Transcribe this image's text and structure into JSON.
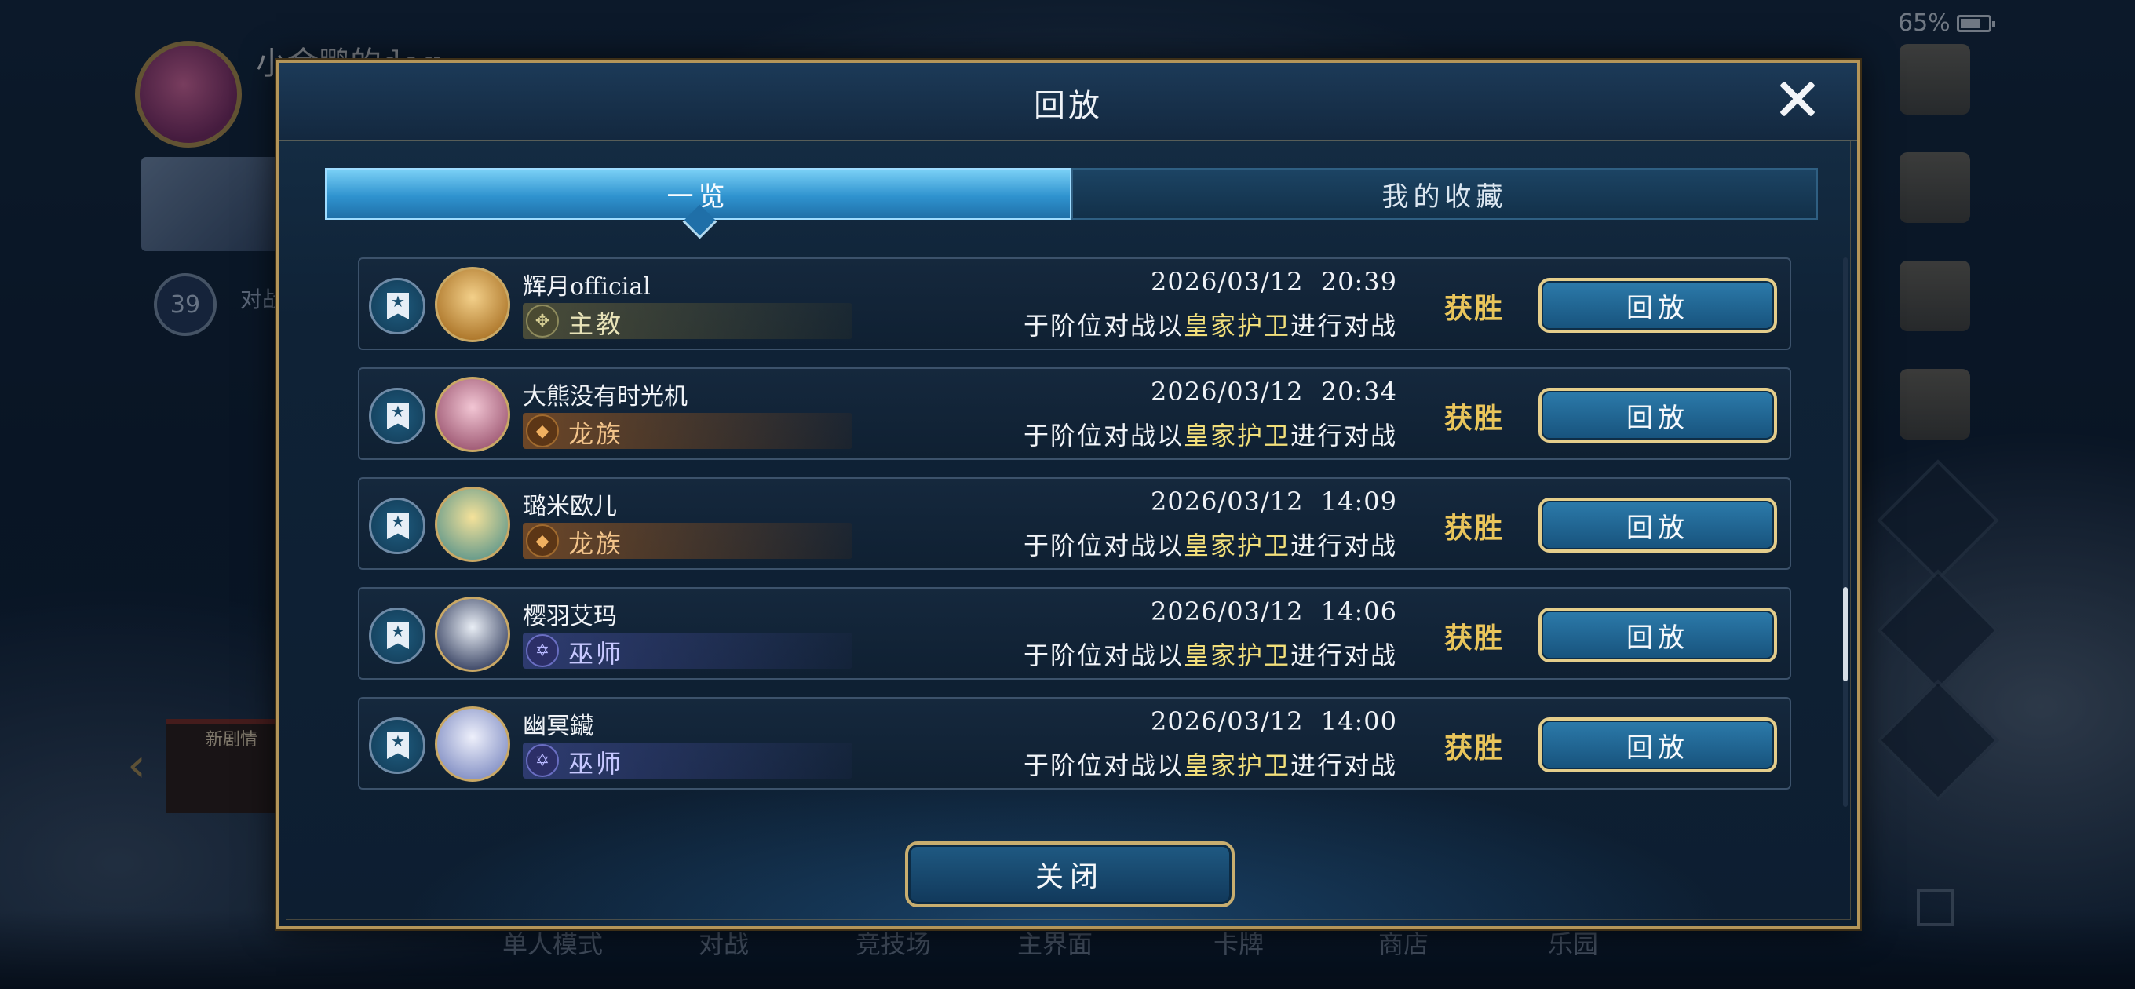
{
  "status_bar": {
    "battery": "65%"
  },
  "background": {
    "player_name": "小金鹏的dog",
    "level": "39",
    "level_text": "对战经验",
    "new_story": "新剧情",
    "nav": [
      "单人模式",
      "对战",
      "竞技场",
      "主界面",
      "卡牌",
      "商店",
      "乐园"
    ]
  },
  "modal": {
    "title": "回放",
    "tabs": [
      {
        "label": "一览",
        "active": true
      },
      {
        "label": "我的收藏",
        "active": false
      }
    ],
    "rows": [
      {
        "player": "辉月official",
        "class_name": "主教",
        "class_type": "priest",
        "datetime": "2026/03/12  20:39",
        "desc_prefix": "于阶位对战以",
        "desc_highlight": "皇家护卫",
        "desc_suffix": "进行对战",
        "result": "获胜",
        "button": "回放"
      },
      {
        "player": "大熊没有时光机",
        "class_name": "龙族",
        "class_type": "dragon",
        "datetime": "2026/03/12  20:34",
        "desc_prefix": "于阶位对战以",
        "desc_highlight": "皇家护卫",
        "desc_suffix": "进行对战",
        "result": "获胜",
        "button": "回放"
      },
      {
        "player": "璐米欧儿",
        "class_name": "龙族",
        "class_type": "dragon",
        "datetime": "2026/03/12  14:09",
        "desc_prefix": "于阶位对战以",
        "desc_highlight": "皇家护卫",
        "desc_suffix": "进行对战",
        "result": "获胜",
        "button": "回放"
      },
      {
        "player": "樱羽艾玛",
        "class_name": "巫师",
        "class_type": "mage",
        "datetime": "2026/03/12  14:06",
        "desc_prefix": "于阶位对战以",
        "desc_highlight": "皇家护卫",
        "desc_suffix": "进行对战",
        "result": "获胜",
        "button": "回放"
      },
      {
        "player": "幽冥鑶",
        "class_name": "巫师",
        "class_type": "mage",
        "datetime": "2026/03/12  14:00",
        "desc_prefix": "于阶位对战以",
        "desc_highlight": "皇家护卫",
        "desc_suffix": "进行对战",
        "result": "获胜",
        "button": "回放"
      }
    ],
    "close_label": "关闭"
  },
  "colors": {
    "accent_gold": "#b49559",
    "win_gold": "#e9c55b",
    "highlight": "#f1de7a",
    "tab_active": "#2f93cf"
  },
  "icons": [
    "close-icon",
    "favorite-bookmark-icon",
    "priest-class-icon",
    "dragon-class-icon",
    "mage-class-icon",
    "grid-menu-icon",
    "image-edit-icon",
    "gift-icon",
    "scroll-icon",
    "checkmark-icon",
    "expand-icon"
  ]
}
